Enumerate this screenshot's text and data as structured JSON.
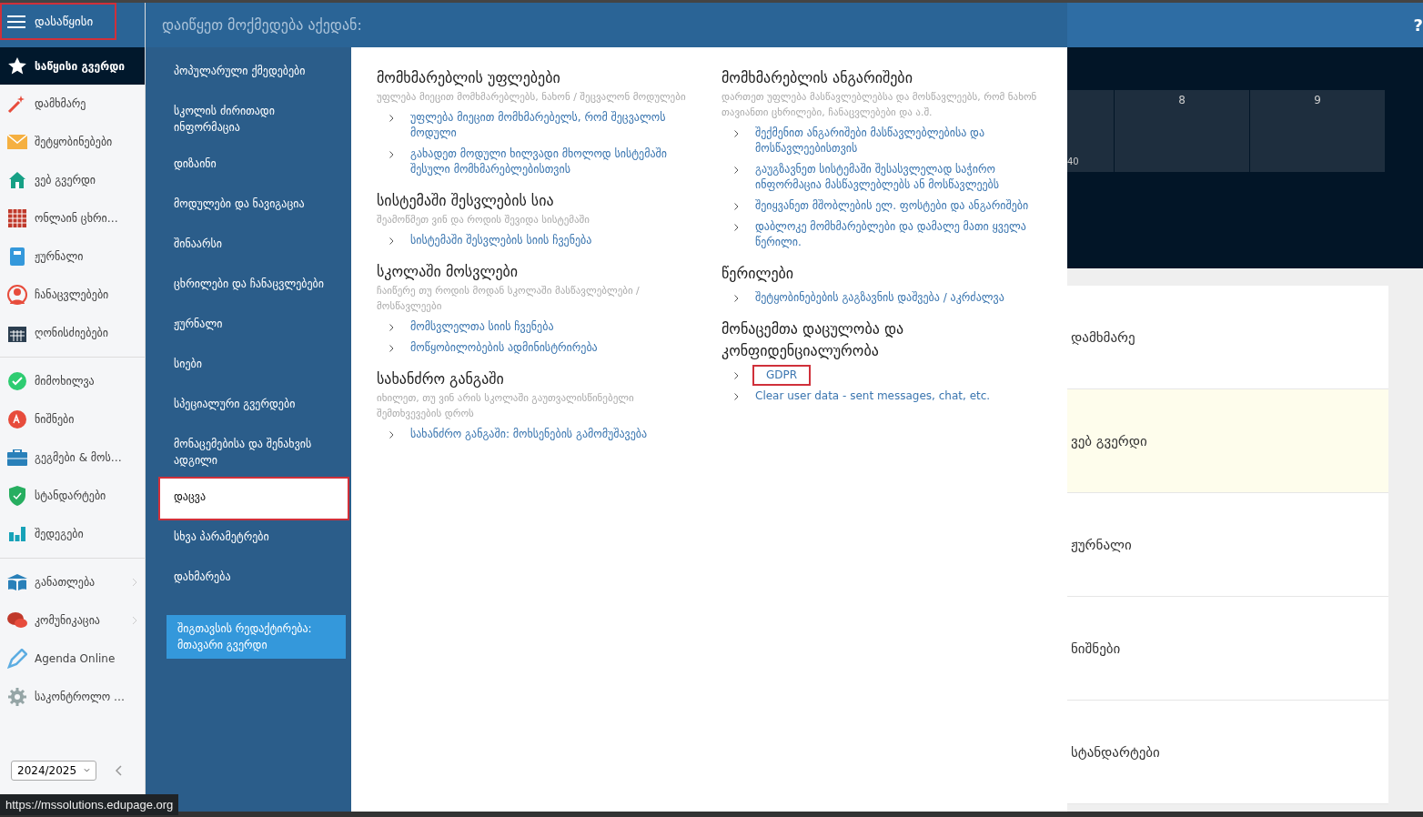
{
  "sidebar": {
    "start": {
      "label": "დასაწყისი",
      "highlighted": true
    },
    "groups": [
      [
        {
          "label": "საწყისი გვერდი",
          "selected": true,
          "expandable": false
        },
        {
          "label": "დამხმარე",
          "selected": false,
          "expandable": false
        },
        {
          "label": "შეტყობინებები",
          "selected": false,
          "expandable": false
        },
        {
          "label": "ვებ გვერდი",
          "selected": false,
          "expandable": false
        },
        {
          "label": "ონლაინ ცხრი…",
          "selected": false,
          "expandable": false
        },
        {
          "label": "ჟურნალი",
          "selected": false,
          "expandable": false
        },
        {
          "label": "ჩანაცვლებები",
          "selected": false,
          "expandable": false
        },
        {
          "label": "ღონისძიებები",
          "selected": false,
          "expandable": false
        }
      ],
      [
        {
          "label": "მიმოხილვა",
          "selected": false,
          "expandable": false
        },
        {
          "label": "ნიშნები",
          "selected": false,
          "expandable": false
        },
        {
          "label": "გეგმები & მოს…",
          "selected": false,
          "expandable": false
        },
        {
          "label": "სტანდარტები",
          "selected": false,
          "expandable": false
        },
        {
          "label": "შედეგები",
          "selected": false,
          "expandable": false
        }
      ],
      [
        {
          "label": "განათლება",
          "selected": false,
          "expandable": true
        },
        {
          "label": "კომუნიკაცია",
          "selected": false,
          "expandable": true
        },
        {
          "label": "Agenda Online",
          "selected": false,
          "expandable": false
        },
        {
          "label": "საკონტროლო …",
          "selected": false,
          "expandable": false
        }
      ]
    ],
    "season": "2024/2025"
  },
  "menu": {
    "title": "დაიწყეთ მოქმედება აქედან:",
    "items": [
      {
        "label": "პოპულარული ქმედებები",
        "selected": false,
        "highlighted": false
      },
      {
        "label": "სკოლის ძირითადი ინფორმაცია",
        "selected": false,
        "highlighted": false
      },
      {
        "label": "დიზაინი",
        "selected": false,
        "highlighted": false
      },
      {
        "label": "მოდულები და ნავიგაცია",
        "selected": false,
        "highlighted": false
      },
      {
        "label": "შინაარსი",
        "selected": false,
        "highlighted": false
      },
      {
        "label": "ცხრილები და ჩანაცვლებები",
        "selected": false,
        "highlighted": false
      },
      {
        "label": "ჟურნალი",
        "selected": false,
        "highlighted": false
      },
      {
        "label": "სიები",
        "selected": false,
        "highlighted": false
      },
      {
        "label": "სპეციალური გვერდები",
        "selected": false,
        "highlighted": false
      },
      {
        "label": "მონაცემებისა და შენახვის ადგილი",
        "selected": false,
        "highlighted": false
      },
      {
        "label": "დაცვა",
        "selected": true,
        "highlighted": true
      },
      {
        "label": "სხვა პარამეტრები",
        "selected": false,
        "highlighted": false
      },
      {
        "label": "დახმარება",
        "selected": false,
        "highlighted": false
      }
    ],
    "edit_button": "შიგთავსის რედაქტირება: მთავარი გვერდი"
  },
  "content": {
    "columns": [
      [
        {
          "title": "მომხმარებლის უფლებები",
          "description": "უფლება მიეცით მომხმარებლებს, ნახონ / შეცვალონ მოდულები",
          "links": [
            {
              "text": "უფლება მიეცით მომხმარებელს, რომ შეცვალოს მოდული",
              "highlighted": false
            },
            {
              "text": "გახადეთ მოდული ხილვადი მხოლოდ სისტემაში შესული მომხმარებლებისთვის",
              "highlighted": false
            }
          ]
        },
        {
          "title": "სისტემაში შესვლების სია",
          "description": "შეამოწმეთ ვინ და როდის შევიდა სისტემაში",
          "links": [
            {
              "text": "სისტემაში შესვლების სიის ჩვენება",
              "highlighted": false
            }
          ]
        },
        {
          "title": "სკოლაში მოსვლები",
          "description": "ჩაიწერე თუ როდის მოდან სკოლაში მასწავლებლები / მოსწავლეები",
          "links": [
            {
              "text": "მომსვლელთა სიის ჩვენება",
              "highlighted": false
            },
            {
              "text": "მოწყობილობების ადმინისტრირება",
              "highlighted": false
            }
          ]
        },
        {
          "title": "სახანძრო განგაში",
          "description": "იხილეთ, თუ ვინ არის სკოლაში გაუთვალისწინებელი შემთხვევების დროს",
          "links": [
            {
              "text": "სახანძრო განგაში: მოხსენების გამომუშავება",
              "highlighted": false
            }
          ]
        }
      ],
      [
        {
          "title": "მომხმარებლის ანგარიშები",
          "description": "დართეთ უფლება მასწავლებლებსა და მოსწავლეებს, რომ ნახონ თავიანთი ცხრილები, ჩანაცვლებები და ა.შ.",
          "links": [
            {
              "text": "შექმენით ანგარიშები მასწავლებლებისა და მოსწავლეებისთვის",
              "highlighted": false
            },
            {
              "text": "გაუგზავნეთ სისტემაში შესასვლელად საჭირო ინფორმაცია მასწავლებლებს ან მოსწავლეებს",
              "highlighted": false
            },
            {
              "text": "შეიყვანეთ მშობლების ელ. ფოსტები და ანგარიშები",
              "highlighted": false
            },
            {
              "text": "დაბლოკე მომხმარებლები და დამალე მათი ყველა წერილი.",
              "highlighted": false
            }
          ]
        },
        {
          "title": "წერილები",
          "links": [
            {
              "text": "შეტყობინებების გაგზავნის დაშვება / აკრძალვა",
              "highlighted": false
            }
          ]
        },
        {
          "title": "მონაცემთა დაცულობა და კონფიდენციალურობა",
          "links": [
            {
              "text": "GDPR",
              "highlighted": true
            },
            {
              "text": "Clear user data - sent messages, chat, etc.",
              "highlighted": false
            }
          ]
        }
      ]
    ]
  },
  "background": {
    "help": "?",
    "timetable": [
      "40",
      "8",
      "9"
    ],
    "cards": [
      {
        "label": "დამხმარე",
        "highlighted": false
      },
      {
        "label": "ვებ გვერდი",
        "highlighted": true
      },
      {
        "label": "ჟურნალი",
        "highlighted": false
      },
      {
        "label": "ნიშნები",
        "highlighted": false
      },
      {
        "label": "სტანდარტები",
        "highlighted": false
      }
    ]
  },
  "status_url": "https://mssolutions.edupage.org"
}
